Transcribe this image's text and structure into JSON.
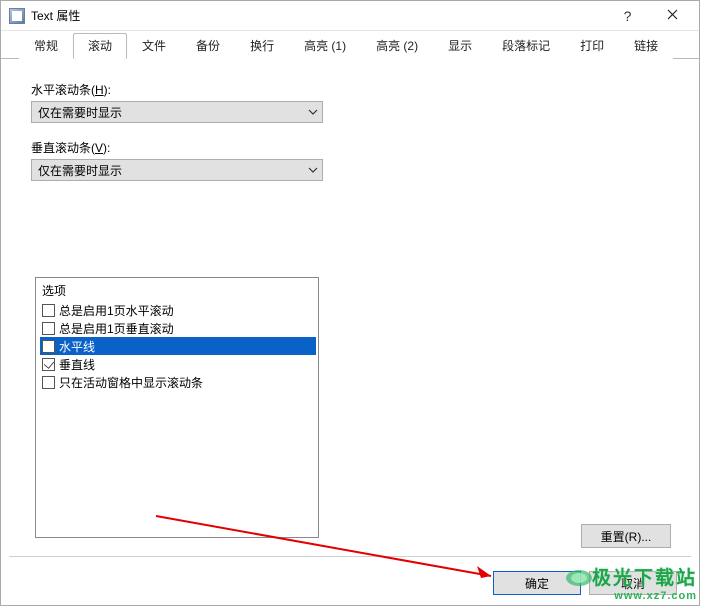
{
  "window": {
    "title": "Text 属性"
  },
  "titlebar": {
    "help": "?",
    "close": "×"
  },
  "tabs": [
    {
      "label": "常规"
    },
    {
      "label": "滚动"
    },
    {
      "label": "文件"
    },
    {
      "label": "备份"
    },
    {
      "label": "换行"
    },
    {
      "label": "高亮 (1)"
    },
    {
      "label": "高亮 (2)"
    },
    {
      "label": "显示"
    },
    {
      "label": "段落标记"
    },
    {
      "label": "打印"
    },
    {
      "label": "链接"
    }
  ],
  "active_tab_index": 1,
  "hscroll": {
    "label_prefix": "水平滚动条(",
    "label_key": "H",
    "label_suffix": "):",
    "value": "仅在需要时显示"
  },
  "vscroll": {
    "label_prefix": "垂直滚动条(",
    "label_key": "V",
    "label_suffix": "):",
    "value": "仅在需要时显示"
  },
  "options": {
    "title": "选项",
    "items": [
      {
        "label": "总是启用1页水平滚动",
        "checked": false
      },
      {
        "label": "总是启用1页垂直滚动",
        "checked": false
      },
      {
        "label": "水平线",
        "checked": false
      },
      {
        "label": "垂直线",
        "checked": true
      },
      {
        "label": "只在活动窗格中显示滚动条",
        "checked": false
      }
    ],
    "selected_index": 2
  },
  "buttons": {
    "reset": "重置(R)...",
    "ok": "确定",
    "cancel": "取消"
  },
  "watermark": {
    "main": "极光下载站",
    "sub": "www.xz7.com"
  }
}
